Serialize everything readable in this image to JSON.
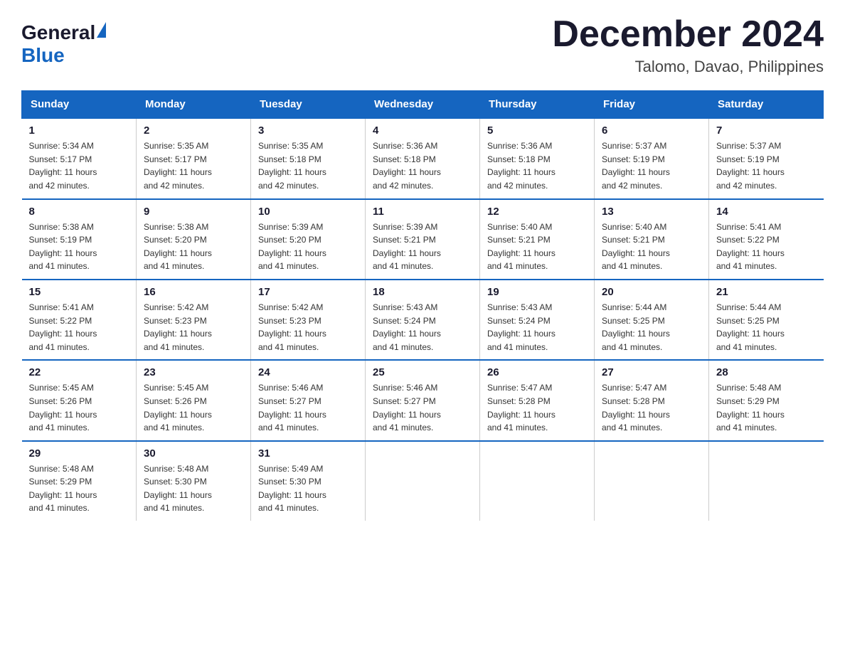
{
  "header": {
    "logo_general": "General",
    "logo_blue": "Blue",
    "month_title": "December 2024",
    "location": "Talomo, Davao, Philippines"
  },
  "days_of_week": [
    "Sunday",
    "Monday",
    "Tuesday",
    "Wednesday",
    "Thursday",
    "Friday",
    "Saturday"
  ],
  "weeks": [
    [
      {
        "day": "1",
        "sunrise": "5:34 AM",
        "sunset": "5:17 PM",
        "daylight": "11 hours and 42 minutes."
      },
      {
        "day": "2",
        "sunrise": "5:35 AM",
        "sunset": "5:17 PM",
        "daylight": "11 hours and 42 minutes."
      },
      {
        "day": "3",
        "sunrise": "5:35 AM",
        "sunset": "5:18 PM",
        "daylight": "11 hours and 42 minutes."
      },
      {
        "day": "4",
        "sunrise": "5:36 AM",
        "sunset": "5:18 PM",
        "daylight": "11 hours and 42 minutes."
      },
      {
        "day": "5",
        "sunrise": "5:36 AM",
        "sunset": "5:18 PM",
        "daylight": "11 hours and 42 minutes."
      },
      {
        "day": "6",
        "sunrise": "5:37 AM",
        "sunset": "5:19 PM",
        "daylight": "11 hours and 42 minutes."
      },
      {
        "day": "7",
        "sunrise": "5:37 AM",
        "sunset": "5:19 PM",
        "daylight": "11 hours and 42 minutes."
      }
    ],
    [
      {
        "day": "8",
        "sunrise": "5:38 AM",
        "sunset": "5:19 PM",
        "daylight": "11 hours and 41 minutes."
      },
      {
        "day": "9",
        "sunrise": "5:38 AM",
        "sunset": "5:20 PM",
        "daylight": "11 hours and 41 minutes."
      },
      {
        "day": "10",
        "sunrise": "5:39 AM",
        "sunset": "5:20 PM",
        "daylight": "11 hours and 41 minutes."
      },
      {
        "day": "11",
        "sunrise": "5:39 AM",
        "sunset": "5:21 PM",
        "daylight": "11 hours and 41 minutes."
      },
      {
        "day": "12",
        "sunrise": "5:40 AM",
        "sunset": "5:21 PM",
        "daylight": "11 hours and 41 minutes."
      },
      {
        "day": "13",
        "sunrise": "5:40 AM",
        "sunset": "5:21 PM",
        "daylight": "11 hours and 41 minutes."
      },
      {
        "day": "14",
        "sunrise": "5:41 AM",
        "sunset": "5:22 PM",
        "daylight": "11 hours and 41 minutes."
      }
    ],
    [
      {
        "day": "15",
        "sunrise": "5:41 AM",
        "sunset": "5:22 PM",
        "daylight": "11 hours and 41 minutes."
      },
      {
        "day": "16",
        "sunrise": "5:42 AM",
        "sunset": "5:23 PM",
        "daylight": "11 hours and 41 minutes."
      },
      {
        "day": "17",
        "sunrise": "5:42 AM",
        "sunset": "5:23 PM",
        "daylight": "11 hours and 41 minutes."
      },
      {
        "day": "18",
        "sunrise": "5:43 AM",
        "sunset": "5:24 PM",
        "daylight": "11 hours and 41 minutes."
      },
      {
        "day": "19",
        "sunrise": "5:43 AM",
        "sunset": "5:24 PM",
        "daylight": "11 hours and 41 minutes."
      },
      {
        "day": "20",
        "sunrise": "5:44 AM",
        "sunset": "5:25 PM",
        "daylight": "11 hours and 41 minutes."
      },
      {
        "day": "21",
        "sunrise": "5:44 AM",
        "sunset": "5:25 PM",
        "daylight": "11 hours and 41 minutes."
      }
    ],
    [
      {
        "day": "22",
        "sunrise": "5:45 AM",
        "sunset": "5:26 PM",
        "daylight": "11 hours and 41 minutes."
      },
      {
        "day": "23",
        "sunrise": "5:45 AM",
        "sunset": "5:26 PM",
        "daylight": "11 hours and 41 minutes."
      },
      {
        "day": "24",
        "sunrise": "5:46 AM",
        "sunset": "5:27 PM",
        "daylight": "11 hours and 41 minutes."
      },
      {
        "day": "25",
        "sunrise": "5:46 AM",
        "sunset": "5:27 PM",
        "daylight": "11 hours and 41 minutes."
      },
      {
        "day": "26",
        "sunrise": "5:47 AM",
        "sunset": "5:28 PM",
        "daylight": "11 hours and 41 minutes."
      },
      {
        "day": "27",
        "sunrise": "5:47 AM",
        "sunset": "5:28 PM",
        "daylight": "11 hours and 41 minutes."
      },
      {
        "day": "28",
        "sunrise": "5:48 AM",
        "sunset": "5:29 PM",
        "daylight": "11 hours and 41 minutes."
      }
    ],
    [
      {
        "day": "29",
        "sunrise": "5:48 AM",
        "sunset": "5:29 PM",
        "daylight": "11 hours and 41 minutes."
      },
      {
        "day": "30",
        "sunrise": "5:48 AM",
        "sunset": "5:30 PM",
        "daylight": "11 hours and 41 minutes."
      },
      {
        "day": "31",
        "sunrise": "5:49 AM",
        "sunset": "5:30 PM",
        "daylight": "11 hours and 41 minutes."
      },
      null,
      null,
      null,
      null
    ]
  ],
  "labels": {
    "sunrise": "Sunrise:",
    "sunset": "Sunset:",
    "daylight": "Daylight:"
  }
}
